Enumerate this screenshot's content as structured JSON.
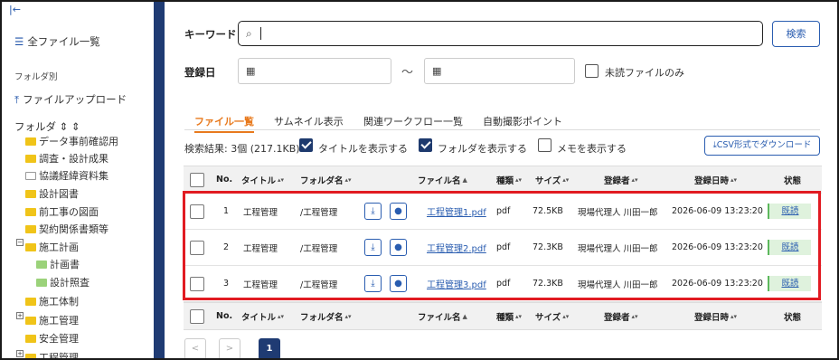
{
  "sidebar": {
    "all_files": "全ファイル一覧",
    "by_folder": "フォルダ別",
    "upload": "ファイルアップロード",
    "folder_header": "フォルダ",
    "tree": [
      {
        "label": "データ事前確認用"
      },
      {
        "label": "調査・設計成果"
      },
      {
        "label": "協議経緯資料集"
      },
      {
        "label": "設計図書"
      },
      {
        "label": "前工事の図面"
      },
      {
        "label": "契約関係書類等"
      },
      {
        "label": "施工計画"
      },
      {
        "label": "計画書"
      },
      {
        "label": "設計照査"
      },
      {
        "label": "施工体制"
      },
      {
        "label": "施工管理"
      },
      {
        "label": "安全管理"
      },
      {
        "label": "工程管理"
      }
    ]
  },
  "search": {
    "keyword_label": "キーワード",
    "keyword_value": "",
    "search_button": "検索",
    "date_label": "登録日",
    "date_sep": "～",
    "unread_only": "未読ファイルのみ"
  },
  "tabs": [
    "ファイル一覧",
    "サムネイル表示",
    "関連ワークフロー一覧",
    "自動撮影ポイント"
  ],
  "results": {
    "summary": "検索結果: 3個 (217.1KB)",
    "show_title": "タイトルを表示する",
    "show_folder": "フォルダを表示する",
    "show_memo": "メモを表示する",
    "csv_button": "CSV形式でダウンロード"
  },
  "table": {
    "headers": {
      "no": "No.",
      "title": "タイトル",
      "folder": "フォルダ名",
      "file": "ファイル名",
      "type": "種類",
      "size": "サイズ",
      "user": "登録者",
      "date": "登録日時",
      "status": "状態"
    },
    "rows": [
      {
        "no": "1",
        "title": "工程管理",
        "folder": "/工程管理",
        "file": "工程管理1.pdf",
        "type": "pdf",
        "size": "72.5KB",
        "user": "現場代理人 川田一郎",
        "date": "2026-06-09 13:23:20",
        "status": "既読"
      },
      {
        "no": "2",
        "title": "工程管理",
        "folder": "/工程管理",
        "file": "工程管理2.pdf",
        "type": "pdf",
        "size": "72.3KB",
        "user": "現場代理人 川田一郎",
        "date": "2026-06-09 13:23:20",
        "status": "既読"
      },
      {
        "no": "3",
        "title": "工程管理",
        "folder": "/工程管理",
        "file": "工程管理3.pdf",
        "type": "pdf",
        "size": "72.3KB",
        "user": "現場代理人 川田一郎",
        "date": "2026-06-09 13:23:20",
        "status": "既読"
      }
    ]
  },
  "pagination": {
    "prev": "<",
    "next": ">",
    "current": "1"
  },
  "colors": {
    "accent": "#e87a1e",
    "navy": "#1f3b73",
    "link": "#2a5db0",
    "highlight": "#e11b22"
  }
}
